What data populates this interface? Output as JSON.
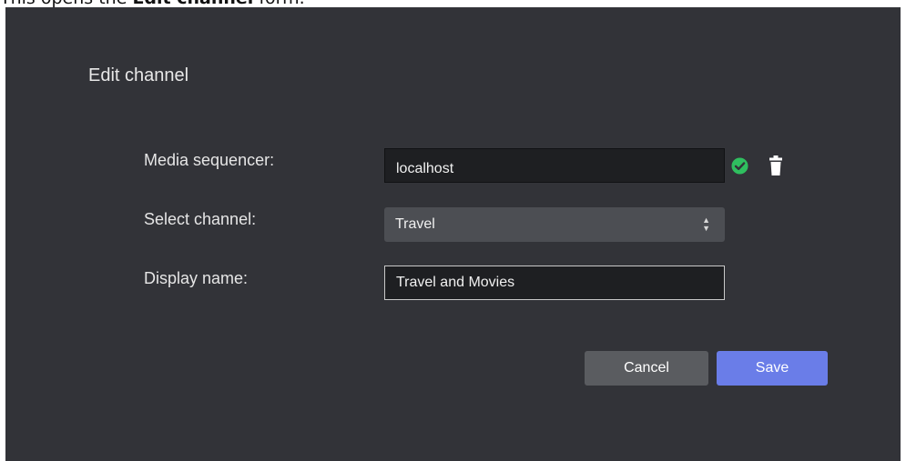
{
  "caption": {
    "pre": "This opens the ",
    "bold": "Edit channel",
    "post": " form."
  },
  "dialog": {
    "title": "Edit channel",
    "fields": {
      "media_sequencer": {
        "label": "Media sequencer:",
        "value": "localhost",
        "status_icon": "check-circle-icon",
        "delete_icon": "trash-icon"
      },
      "channel": {
        "label": "Select channel:",
        "selected": "Travel"
      },
      "display_name": {
        "label": "Display name:",
        "value": "Travel and Movies"
      }
    },
    "buttons": {
      "cancel": "Cancel",
      "save": "Save"
    }
  },
  "colors": {
    "background": "#323338",
    "input_bg": "#1e1f22",
    "select_bg": "#4c4e53",
    "cancel_bg": "#5a5c60",
    "save_bg": "#6a7de8",
    "success": "#2fbf5f"
  }
}
